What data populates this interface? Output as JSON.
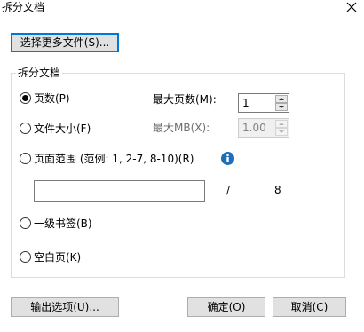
{
  "window": {
    "title": "拆分文档",
    "close_icon": "close-icon"
  },
  "select_files_button": "选择更多文件(S)...",
  "group": {
    "title": "拆分文档",
    "options": {
      "pages": "页数(P)",
      "file_size": "文件大小(F)",
      "page_range": "页面范围 (范例: 1, 2-7, 8-10)(R)",
      "bookmark": "一级书签(B)",
      "blank_page": "空白页(K)"
    },
    "selected": "pages",
    "max_pages": {
      "label": "最大页数(M):",
      "value": "1"
    },
    "max_mb": {
      "label": "最大MB(X):",
      "value": "1.00"
    },
    "range": {
      "value": "",
      "separator": "/",
      "total": "8"
    },
    "info_icon": "info-icon"
  },
  "footer": {
    "output_options": "输出选项(U)...",
    "ok": "确定(O)",
    "cancel": "取消(C)"
  },
  "colors": {
    "focus_border": "#0078d7",
    "info_icon": "#1f6fb8",
    "button_bg": "#e1e1e1"
  }
}
